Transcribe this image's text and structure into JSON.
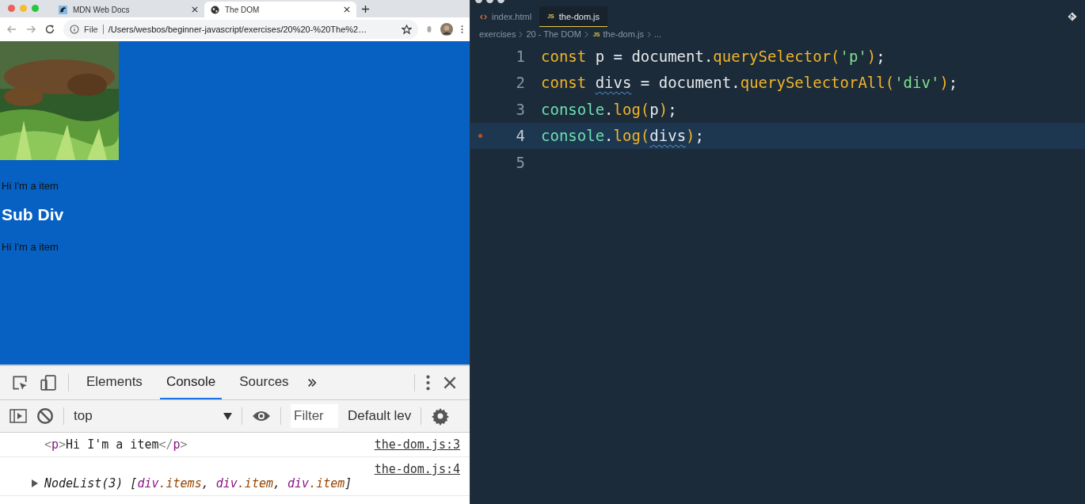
{
  "browser": {
    "tabs": [
      {
        "title": "MDN Web Docs",
        "selected": false
      },
      {
        "title": "The DOM",
        "selected": true
      }
    ],
    "address_bar": {
      "scheme": "File",
      "url": "/Users/wesbos/beginner-javascript/exercises/20%20-%20The%2…"
    },
    "page": {
      "content": [
        {
          "kind": "picture"
        },
        {
          "kind": "text",
          "text": "Hi I'm a item"
        },
        {
          "kind": "heading",
          "text": "Sub Div"
        },
        {
          "kind": "text",
          "text": "Hi I'm a item"
        }
      ]
    },
    "devtools": {
      "tabs": [
        {
          "label": "Elements",
          "selected": false
        },
        {
          "label": "Console",
          "selected": true
        },
        {
          "label": "Sources",
          "selected": false
        }
      ],
      "context": "top",
      "filter": {
        "placeholder": "Filter"
      },
      "levels": "Default lev",
      "console": [
        {
          "expandable": false,
          "source": "the-dom.js:3",
          "tokens": [
            {
              "text": "<",
              "kind": "tag"
            },
            {
              "text": "p",
              "kind": "name"
            },
            {
              "text": ">",
              "kind": "tag"
            },
            {
              "text": "Hi I'm a item",
              "kind": "text"
            },
            {
              "text": "</",
              "kind": "tag"
            },
            {
              "text": "p",
              "kind": "name"
            },
            {
              "text": ">",
              "kind": "tag"
            }
          ]
        },
        {
          "expandable": true,
          "source": "the-dom.js:4",
          "tokens": [
            {
              "text": "NodeList(3) [",
              "kind": "italic"
            },
            {
              "text": "div",
              "kind": "name"
            },
            {
              "text": ".items",
              "kind": "prop"
            },
            {
              "text": ", ",
              "kind": "italic"
            },
            {
              "text": "div",
              "kind": "name"
            },
            {
              "text": ".item",
              "kind": "prop"
            },
            {
              "text": ", ",
              "kind": "italic"
            },
            {
              "text": "div",
              "kind": "name"
            },
            {
              "text": ".item",
              "kind": "prop"
            },
            {
              "text": "]",
              "kind": "italic"
            }
          ]
        }
      ]
    }
  },
  "editor": {
    "tabs": [
      {
        "label": "index.html",
        "kind": "html",
        "selected": false
      },
      {
        "label": "the-dom.js",
        "kind": "js",
        "badge": "JS",
        "selected": true
      }
    ],
    "breadcrumbs": [
      {
        "label": "exercises"
      },
      {
        "label": "20 - The DOM"
      },
      {
        "label": "the-dom.js",
        "badge": "JS"
      },
      {
        "label": "..."
      }
    ],
    "lines": [
      {
        "number": "1",
        "current": false,
        "modified": false,
        "tokens": [
          {
            "text": "const",
            "kind": "keyword"
          },
          {
            "text": " p = document.",
            "kind": "plain"
          },
          {
            "text": "querySelector",
            "kind": "func"
          },
          {
            "text": "(",
            "kind": "paren"
          },
          {
            "text": "'p'",
            "kind": "string"
          },
          {
            "text": ")",
            "kind": "paren"
          },
          {
            "text": ";",
            "kind": "plain"
          }
        ]
      },
      {
        "number": "2",
        "current": false,
        "modified": false,
        "tokens": [
          {
            "text": "const",
            "kind": "keyword"
          },
          {
            "text": "divs",
            "kind": "squiggly"
          },
          {
            "text": " = document.",
            "kind": "plain"
          },
          {
            "text": "querySelectorAll",
            "kind": "func"
          },
          {
            "text": "(",
            "kind": "paren"
          },
          {
            "text": "'div'",
            "kind": "string"
          },
          {
            "text": ")",
            "kind": "paren"
          },
          {
            "text": ";",
            "kind": "plain"
          }
        ]
      },
      {
        "number": "3",
        "current": false,
        "modified": false,
        "tokens": [
          {
            "text": "console",
            "kind": "object"
          },
          {
            "text": ".",
            "kind": "plain"
          },
          {
            "text": "log",
            "kind": "func"
          },
          {
            "text": "(",
            "kind": "paren"
          },
          {
            "text": "p",
            "kind": "plain"
          },
          {
            "text": ")",
            "kind": "paren"
          },
          {
            "text": ";",
            "kind": "plain"
          }
        ]
      },
      {
        "number": "4",
        "current": true,
        "modified": true,
        "tokens": [
          {
            "text": "console",
            "kind": "object"
          },
          {
            "text": ".",
            "kind": "plain"
          },
          {
            "text": "log",
            "kind": "func"
          },
          {
            "text": "(",
            "kind": "paren"
          },
          {
            "text": "divs",
            "kind": "squiggly"
          },
          {
            "text": ")",
            "kind": "paren"
          },
          {
            "text": ";",
            "kind": "plain"
          }
        ]
      },
      {
        "number": "5",
        "current": false,
        "modified": false
      }
    ]
  }
}
